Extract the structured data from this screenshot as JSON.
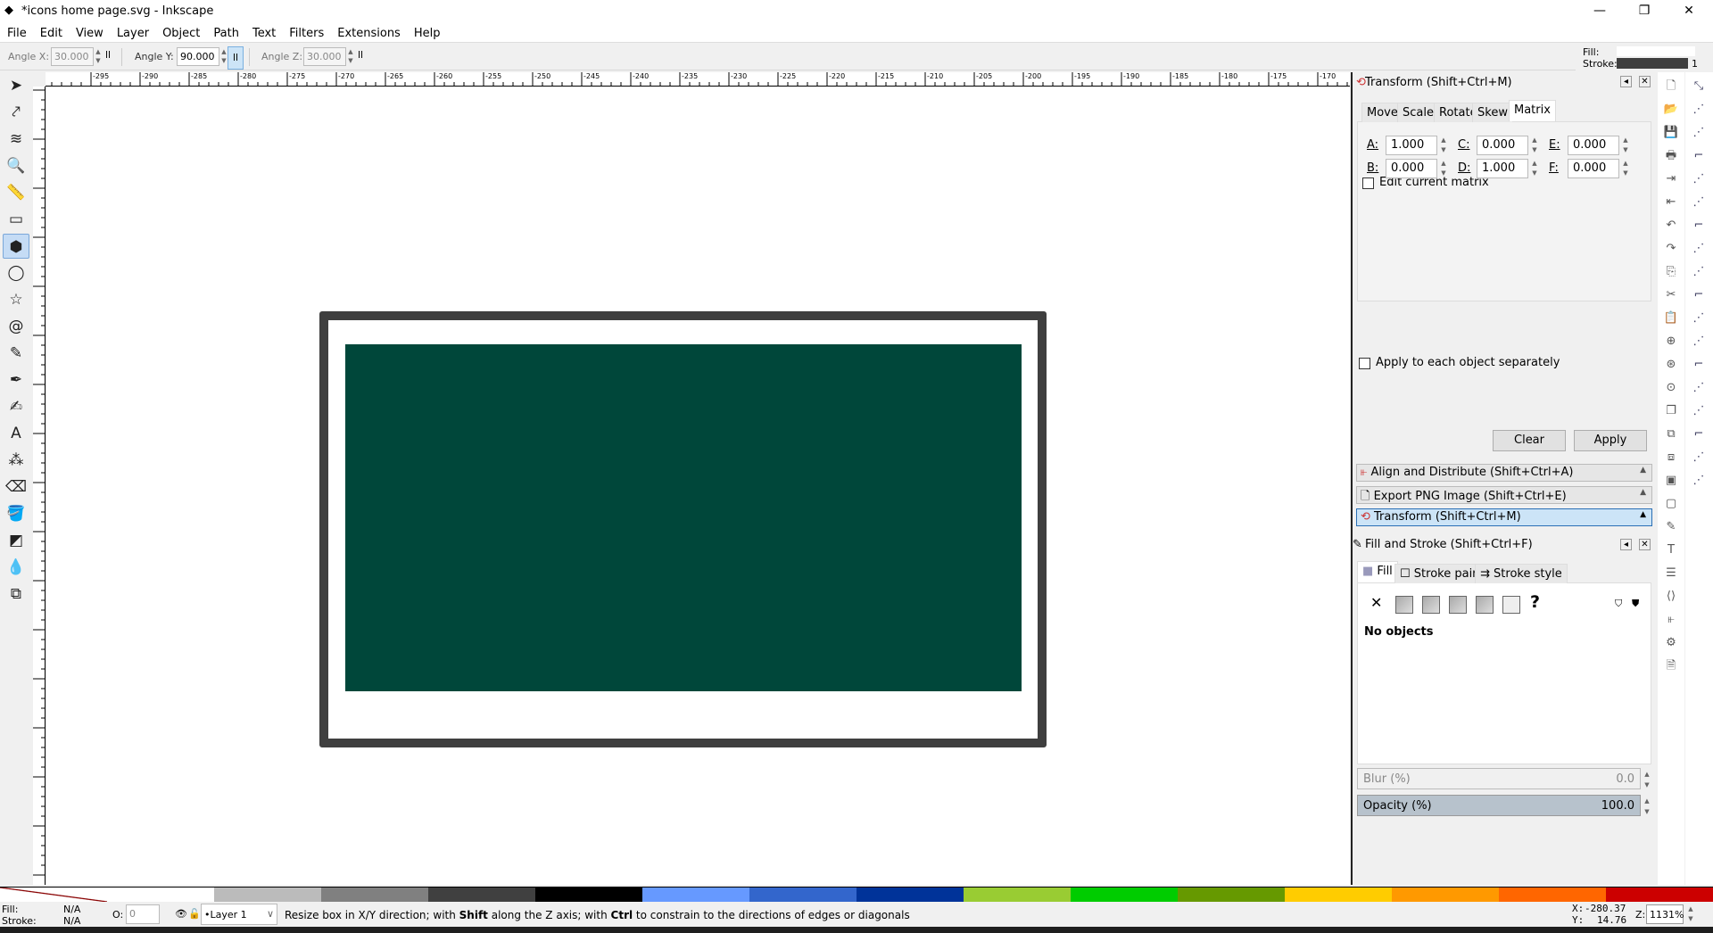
{
  "window": {
    "title": "*icons home page.svg - Inkscape",
    "min": "—",
    "restore": "❐",
    "close": "✕"
  },
  "menu": [
    "File",
    "Edit",
    "View",
    "Layer",
    "Object",
    "Path",
    "Text",
    "Filters",
    "Extensions",
    "Help"
  ],
  "tool_controls": {
    "angle_x": {
      "label": "Angle X:",
      "value": "30.000"
    },
    "angle_y": {
      "label": "Angle Y:",
      "value": "90.000"
    },
    "angle_z": {
      "label": "Angle Z:",
      "value": "30.000"
    },
    "vp_glyph": "ll"
  },
  "style_indicator": {
    "fill_label": "Fill:",
    "stroke_label": "Stroke:",
    "stroke_width": "1",
    "stroke_color": "#3f3f3f"
  },
  "ruler": {
    "labels": [
      "-295",
      "-290",
      "-285",
      "-280",
      "-275",
      "-270",
      "-265",
      "-260",
      "-255",
      "-250",
      "-245",
      "-240",
      "-235",
      "-230",
      "-225",
      "-220",
      "-215",
      "-210",
      "-205",
      "-200",
      "-195",
      "-190",
      "-185",
      "-180",
      "-175",
      "-170"
    ]
  },
  "tools": [
    {
      "name": "selector-tool",
      "glyph": "➤"
    },
    {
      "name": "node-tool",
      "glyph": "⤤"
    },
    {
      "name": "tweak-tool",
      "glyph": "≋"
    },
    {
      "name": "zoom-tool",
      "glyph": "🔍"
    },
    {
      "name": "measure-tool",
      "glyph": "📏"
    },
    {
      "name": "rectangle-tool",
      "glyph": "▭"
    },
    {
      "name": "3d-box-tool",
      "glyph": "⬢",
      "selected": true
    },
    {
      "name": "ellipse-tool",
      "glyph": "◯"
    },
    {
      "name": "star-tool",
      "glyph": "☆"
    },
    {
      "name": "spiral-tool",
      "glyph": "@"
    },
    {
      "name": "pencil-tool",
      "glyph": "✎"
    },
    {
      "name": "pen-tool",
      "glyph": "✒"
    },
    {
      "name": "calligraphy-tool",
      "glyph": "✍"
    },
    {
      "name": "text-tool",
      "glyph": "A"
    },
    {
      "name": "spray-tool",
      "glyph": "⁂"
    },
    {
      "name": "eraser-tool",
      "glyph": "⌫"
    },
    {
      "name": "paint-bucket-tool",
      "glyph": "🪣"
    },
    {
      "name": "gradient-tool",
      "glyph": "◩"
    },
    {
      "name": "dropper-tool",
      "glyph": "💧"
    },
    {
      "name": "connector-tool",
      "glyph": "⧉"
    }
  ],
  "canvas": {
    "page_border_color": "#3f3f3f",
    "rect_fill": "#00473a"
  },
  "transform_panel": {
    "title": "Transform (Shift+Ctrl+M)",
    "tabs": [
      "Move",
      "Scale",
      "Rotate",
      "Skew",
      "Matrix"
    ],
    "active_tab": "Matrix",
    "fields": {
      "A": "1.000",
      "B": "0.000",
      "C": "0.000",
      "D": "1.000",
      "E": "0.000",
      "F": "0.000"
    },
    "labels": {
      "A": "A:",
      "B": "B:",
      "C": "C:",
      "D": "D:",
      "E": "E:",
      "F": "F:"
    },
    "edit_current_matrix": "Edit current matrix",
    "apply_each": "Apply to each object separately",
    "clear": "Clear",
    "apply": "Apply"
  },
  "collapsed_docks": [
    "Align and Distribute (Shift+Ctrl+A)",
    "Export PNG Image (Shift+Ctrl+E)",
    "Transform (Shift+Ctrl+M)"
  ],
  "fill_stroke": {
    "title": "Fill and Stroke (Shift+Ctrl+F)",
    "tabs": [
      "Fill",
      "Stroke paint",
      "Stroke style"
    ],
    "no_objects": "No objects",
    "unset": "?",
    "none": "✕",
    "blur_label": "Blur (%)",
    "blur_value": "0.0",
    "opacity_label": "Opacity (%)",
    "opacity_value": "100.0"
  },
  "palette": [
    "none",
    "#ffffff",
    "#bbbbbb",
    "#808080",
    "#404040",
    "#000000",
    "#6699ff",
    "#3366cc",
    "#003399",
    "#99cc33",
    "#00cc00",
    "#669900",
    "#ffcc00",
    "#ff9900",
    "#ff6600",
    "#cc0000"
  ],
  "status": {
    "fill_label": "Fill:",
    "fill_value": "N/A",
    "stroke_label": "Stroke:",
    "stroke_value": "N/A",
    "opacity_label": "O:",
    "opacity_value": "0",
    "layer": "•Layer 1",
    "message_parts": [
      "Resize box in X/Y direction; with ",
      "Shift",
      " along the Z axis; with ",
      "Ctrl",
      " to constrain to the directions of edges or diagonals"
    ],
    "x_label": "X:",
    "x_value": "-280.37",
    "y_label": "Y:",
    "y_value": "14.76",
    "z_label": "Z:",
    "zoom": "1131%"
  },
  "command_icons": [
    "new-document",
    "open",
    "save",
    "print",
    "import",
    "export",
    "undo",
    "redo",
    "copy",
    "cut",
    "paste",
    "zoom-selection",
    "zoom-drawing",
    "zoom-page",
    "duplicate",
    "clone",
    "unlink-clone",
    "group",
    "ungroup",
    "fill-stroke",
    "text-font",
    "layers",
    "xml-editor",
    "align",
    "preferences",
    "document-properties"
  ],
  "snap_icons": [
    "snap-enable",
    "snap-bbox",
    "snap-bbox-edge",
    "snap-bbox-corner",
    "snap-bbox-midpoint",
    "snap-bbox-center",
    "snap-nodes",
    "snap-path",
    "snap-path-intersection",
    "snap-cusp",
    "snap-smooth",
    "snap-midpoint",
    "snap-object-center",
    "snap-rotation-center",
    "snap-text-baseline",
    "snap-page-border",
    "snap-grid",
    "snap-guide"
  ]
}
